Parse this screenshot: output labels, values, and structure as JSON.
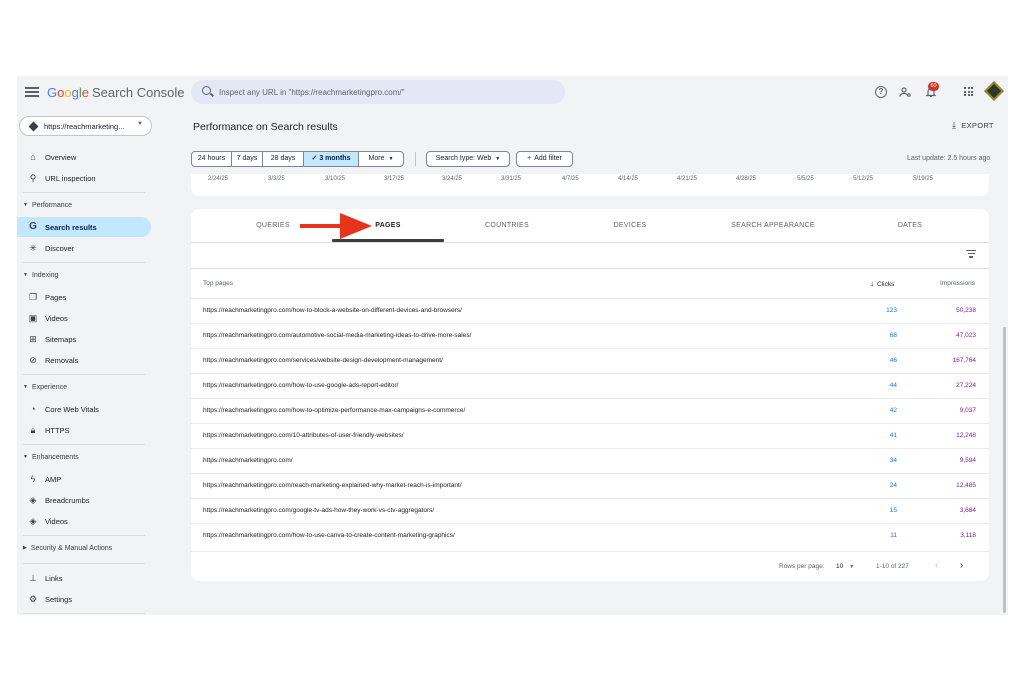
{
  "app": {
    "logo_parts": [
      "G",
      "o",
      "o",
      "g",
      "l",
      "e"
    ],
    "product": "Search Console",
    "search_placeholder": "Inspect any URL in \"https://reachmarketingpro.com/\"",
    "notification_count": "60"
  },
  "sidebar": {
    "property": "https://reachmarketing...",
    "items_top": [
      {
        "label": "Overview",
        "icon": "home-icon"
      },
      {
        "label": "URL inspection",
        "icon": "search-icon"
      }
    ],
    "performance": {
      "title": "Performance",
      "items": [
        {
          "label": "Search results",
          "icon": "google-g-icon"
        },
        {
          "label": "Discover",
          "icon": "asterisk-icon"
        }
      ]
    },
    "indexing": {
      "title": "Indexing",
      "items": [
        {
          "label": "Pages",
          "icon": "pages-icon"
        },
        {
          "label": "Videos",
          "icon": "videos-icon"
        },
        {
          "label": "Sitemaps",
          "icon": "sitemap-icon"
        },
        {
          "label": "Removals",
          "icon": "eye-off-icon"
        }
      ]
    },
    "experience": {
      "title": "Experience",
      "items": [
        {
          "label": "Core Web Vitals",
          "icon": "gauge-icon"
        },
        {
          "label": "HTTPS",
          "icon": "lock-icon"
        }
      ]
    },
    "enhancements": {
      "title": "Enhancements",
      "items": [
        {
          "label": "AMP",
          "icon": "bolt-icon"
        },
        {
          "label": "Breadcrumbs",
          "icon": "layers-icon"
        },
        {
          "label": "Videos",
          "icon": "layers-icon"
        }
      ]
    },
    "security": {
      "title": "Security & Manual Actions"
    },
    "items_bottom": [
      {
        "label": "Links",
        "icon": "links-icon"
      },
      {
        "label": "Settings",
        "icon": "gear-icon"
      }
    ]
  },
  "header": {
    "title": "Performance on Search results",
    "export_label": "EXPORT",
    "last_update": "Last update: 2.5 hours ago"
  },
  "filters": {
    "ranges": [
      "24 hours",
      "7 days",
      "28 days",
      "3 months",
      "More"
    ],
    "selected_range": "3 months",
    "search_type": "Search type: Web",
    "add_filter": "Add filter"
  },
  "chart_axis": {
    "dates": [
      "2/24/25",
      "3/3/25",
      "3/10/25",
      "3/17/25",
      "3/24/25",
      "3/31/25",
      "4/7/25",
      "4/14/25",
      "4/21/25",
      "4/28/25",
      "5/5/25",
      "5/12/25",
      "5/19/25"
    ]
  },
  "tabs": [
    "QUERIES",
    "PAGES",
    "COUNTRIES",
    "DEVICES",
    "SEARCH APPEARANCE",
    "DATES"
  ],
  "active_tab": "PAGES",
  "table": {
    "col_pages": "Top pages",
    "col_clicks": "Clicks",
    "col_impressions": "Impressions",
    "rows": [
      {
        "url": "https://reachmarketingpro.com/how-to-block-a-website-on-different-devices-and-browsers/",
        "clicks": "123",
        "impressions": "50,238"
      },
      {
        "url": "https://reachmarketingpro.com/automotive-social-media-marketing-ideas-to-drive-more-sales/",
        "clicks": "68",
        "impressions": "47,023"
      },
      {
        "url": "https://reachmarketingpro.com/services/website-design-development-management/",
        "clicks": "46",
        "impressions": "167,764"
      },
      {
        "url": "https://reachmarketingpro.com/how-to-use-google-ads-report-editor/",
        "clicks": "44",
        "impressions": "27,224"
      },
      {
        "url": "https://reachmarketingpro.com/how-to-optimize-performance-max-campaigns-e-commerce/",
        "clicks": "42",
        "impressions": "9,037"
      },
      {
        "url": "https://reachmarketingpro.com/10-attributes-of-user-friendly-websites/",
        "clicks": "41",
        "impressions": "12,248"
      },
      {
        "url": "https://reachmarketingpro.com/",
        "clicks": "34",
        "impressions": "9,594"
      },
      {
        "url": "https://reachmarketingpro.com/reach-marketing-explained-why-market-reach-is-important/",
        "clicks": "24",
        "impressions": "12,485"
      },
      {
        "url": "https://reachmarketingpro.com/google-tv-ads-how-they-work-vs-ctv-aggregators/",
        "clicks": "15",
        "impressions": "3,684"
      },
      {
        "url": "https://reachmarketingpro.com/how-to-use-canva-to-create-content-marketing-graphics/",
        "clicks": "11",
        "impressions": "3,118"
      }
    ]
  },
  "pagination": {
    "rows_per_page_label": "Rows per page:",
    "rows_per_page": "10",
    "range": "1-10 of 227"
  },
  "colors": {
    "accent": "#c2e7ff",
    "clicks": "#1a73e8",
    "impressions": "#7b1fa2",
    "annotation_arrow": "#e8341c"
  }
}
